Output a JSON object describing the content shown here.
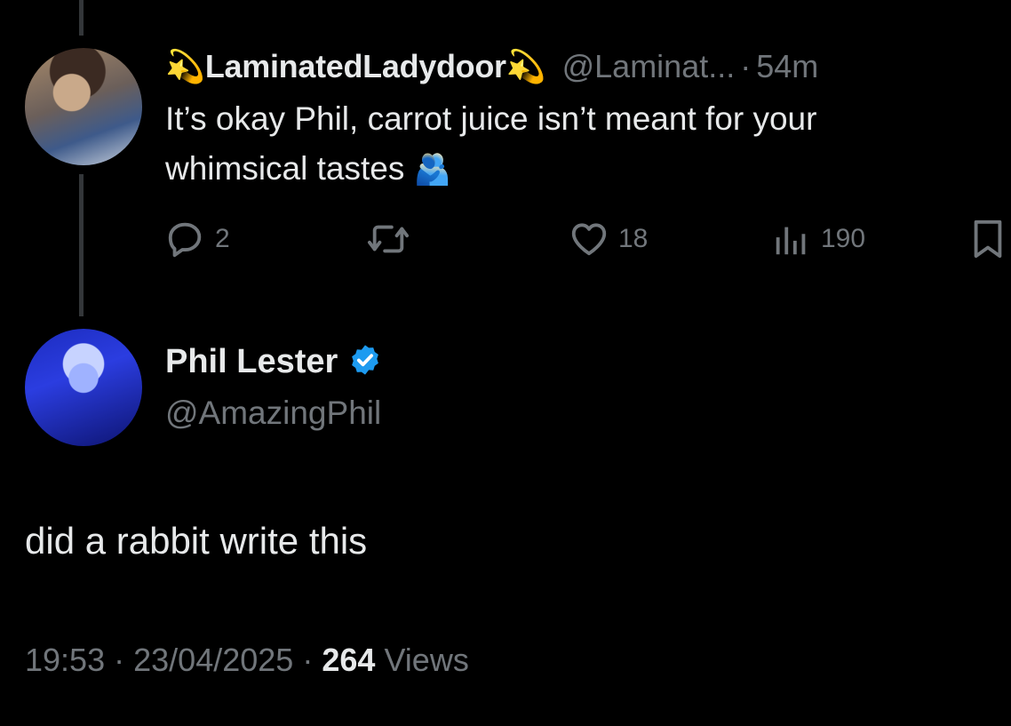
{
  "reply": {
    "emoji_left": "💫",
    "display_name": "LaminatedLadydoor",
    "emoji_right": "💫",
    "handle": "@Laminat...",
    "separator": "·",
    "time": "54m",
    "text_line1": "It’s okay Phil, carrot juice isn’t meant for your",
    "text_line2": "whimsical tastes",
    "text_emoji": "🫂",
    "actions": {
      "replies": "2",
      "retweets": "",
      "likes": "18",
      "views": "190"
    },
    "icons": [
      "reply-icon",
      "retweet-icon",
      "like-icon",
      "views-icon",
      "bookmark-icon"
    ]
  },
  "main": {
    "display_name": "Phil Lester",
    "handle": "@AmazingPhil",
    "text": "did a rabbit write this",
    "time": "19:53",
    "sep1": "·",
    "date": "23/04/2025",
    "sep2": "·",
    "views_count": "264",
    "views_label": "Views"
  },
  "colors": {
    "background": "#000000",
    "text": "#e7e9ea",
    "muted": "#71767b",
    "verified": "#1d9bf0"
  }
}
